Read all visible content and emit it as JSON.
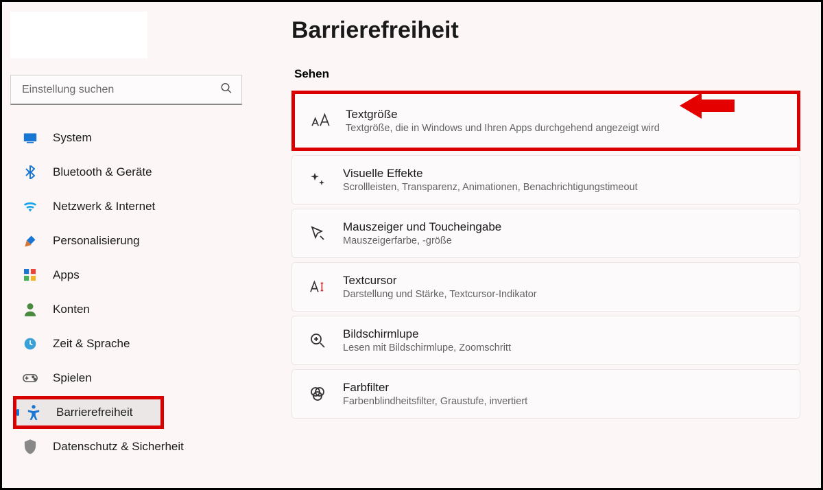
{
  "search": {
    "placeholder": "Einstellung suchen"
  },
  "nav": [
    {
      "label": "System",
      "icon": "system"
    },
    {
      "label": "Bluetooth & Geräte",
      "icon": "bluetooth"
    },
    {
      "label": "Netzwerk & Internet",
      "icon": "network"
    },
    {
      "label": "Personalisierung",
      "icon": "personalize"
    },
    {
      "label": "Apps",
      "icon": "apps"
    },
    {
      "label": "Konten",
      "icon": "accounts"
    },
    {
      "label": "Zeit & Sprache",
      "icon": "time"
    },
    {
      "label": "Spielen",
      "icon": "gaming"
    },
    {
      "label": "Barrierefreiheit",
      "icon": "accessibility"
    },
    {
      "label": "Datenschutz & Sicherheit",
      "icon": "privacy"
    }
  ],
  "page": {
    "title": "Barrierefreiheit",
    "section": "Sehen"
  },
  "cards": [
    {
      "title": "Textgröße",
      "sub": "Textgröße, die in Windows und Ihren Apps durchgehend angezeigt wird",
      "icon": "text-size"
    },
    {
      "title": "Visuelle Effekte",
      "sub": "Scrollleisten, Transparenz, Animationen, Benachrichtigungstimeout",
      "icon": "effects"
    },
    {
      "title": "Mauszeiger und Toucheingabe",
      "sub": "Mauszeigerfarbe, -größe",
      "icon": "pointer"
    },
    {
      "title": "Textcursor",
      "sub": "Darstellung und Stärke, Textcursor-Indikator",
      "icon": "cursor"
    },
    {
      "title": "Bildschirmlupe",
      "sub": "Lesen mit Bildschirmlupe, Zoomschritt",
      "icon": "magnifier"
    },
    {
      "title": "Farbfilter",
      "sub": "Farbenblindheitsfilter, Graustufe, invertiert",
      "icon": "color-filter"
    }
  ]
}
